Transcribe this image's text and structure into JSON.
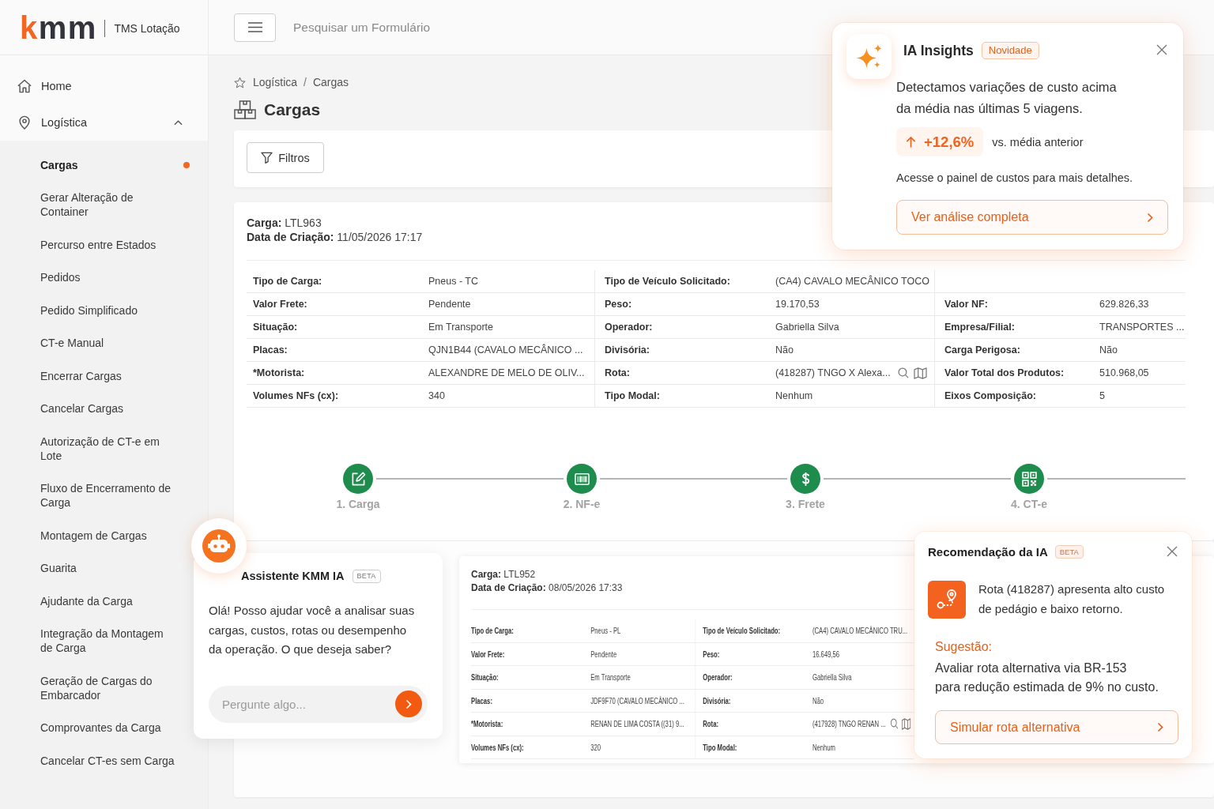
{
  "sidebar": {
    "logo": {
      "accent": "k",
      "text": "mm"
    },
    "product": "TMS Lotação",
    "nav": [
      {
        "kind": "link",
        "label": "Home"
      },
      {
        "kind": "group",
        "label": "Logística",
        "expanded": true,
        "children": [
          {
            "label": "Cargas",
            "selected": true
          },
          {
            "label": "Gerar Alteração de Container",
            "selected": false
          },
          {
            "label": "Percurso entre Estados",
            "selected": false
          },
          {
            "label": "Pedidos",
            "selected": false
          },
          {
            "label": "Pedido Simplificado",
            "selected": false
          },
          {
            "label": "CT-e Manual",
            "selected": false
          },
          {
            "label": "Encerrar Cargas",
            "selected": false
          },
          {
            "label": "Cancelar Cargas",
            "selected": false
          },
          {
            "label": "Autorização de CT-e em Lote",
            "selected": false
          },
          {
            "label": "Fluxo de Encerramento de Carga",
            "selected": false
          },
          {
            "label": "Montagem de Cargas",
            "selected": false
          },
          {
            "label": "Guarita",
            "selected": false
          },
          {
            "label": "Ajudante da Carga",
            "selected": false
          },
          {
            "label": "Integração da Montagem de Carga",
            "selected": false
          },
          {
            "label": "Geração de Cargas do Embarcador",
            "selected": false
          },
          {
            "label": "Comprovantes da Carga",
            "selected": false
          },
          {
            "label": "Cancelar CT-es sem Carga",
            "selected": false
          }
        ]
      }
    ]
  },
  "topbar": {
    "search": {
      "placeholder": "Pesquisar um Formulário"
    }
  },
  "breadcrumb": {
    "items": [
      "Logística",
      "Cargas"
    ],
    "separator": "/"
  },
  "page_title": "Cargas",
  "filters_button": "Filtros",
  "cargo_cards": [
    {
      "kind": "detail",
      "header": [
        {
          "label": "Carga:",
          "value": "LTL963"
        },
        {
          "label": "Data de Criação:",
          "value": "11/05/2026 17:17"
        }
      ],
      "rows": [
        [
          {
            "label": "Tipo de Carga:",
            "value": "Pneus - TC",
            "kind": "text"
          },
          {
            "label": "Tipo de Veículo Solicitado:",
            "value": "(CA4) CAVALO MECÂNICO TOCO",
            "kind": "text"
          }
        ],
        [
          {
            "label": "Valor Frete:",
            "value": "Pendente",
            "kind": "text"
          },
          {
            "label": "Peso:",
            "value": "19.170,53",
            "kind": "text"
          },
          {
            "label": "Valor NF:",
            "value": "629.826,33",
            "kind": "text"
          }
        ],
        [
          {
            "label": "Situação:",
            "value": "Em Transporte",
            "kind": "text"
          },
          {
            "label": "Operador:",
            "value": "Gabriella Silva",
            "kind": "text"
          },
          {
            "label": "Empresa/Filial:",
            "value": "TRANSPORTES ...",
            "kind": "text"
          }
        ],
        [
          {
            "label": "Placas:",
            "value": "QJN1B44 (CAVALO MECÂNICO ...",
            "kind": "text"
          },
          {
            "label": "Divisória:",
            "value": "Não",
            "kind": "text"
          },
          {
            "label": "Carga Perigosa:",
            "value": "Não",
            "kind": "text"
          }
        ],
        [
          {
            "label": "*Motorista:",
            "value": "ALEXANDRE DE MELO DE OLIV...",
            "kind": "text"
          },
          {
            "label": "Rota:",
            "value": "(418287) TNGO X Alexa...",
            "kind": "lookup"
          },
          {
            "label": "Valor Total dos Produtos:",
            "value": "510.968,05",
            "kind": "text"
          }
        ],
        [
          {
            "label": "Volumes NFs (cx):",
            "value": "340",
            "kind": "text"
          },
          {
            "label": "Tipo Modal:",
            "value": "Nenhum",
            "kind": "text"
          },
          {
            "label": "Eixos Composição:",
            "value": "5",
            "kind": "text"
          }
        ]
      ],
      "steps": [
        {
          "label": "1. Carga",
          "completed": true
        },
        {
          "label": "2. NF-e",
          "completed": true
        },
        {
          "label": "3. Frete",
          "completed": true
        },
        {
          "label": "4. CT-e",
          "completed": true
        }
      ]
    },
    {
      "kind": "summary",
      "header": [
        {
          "label": "Carga:",
          "value": "LTL952"
        },
        {
          "label": "Data de Criação:",
          "value": "08/05/2026 17:33"
        }
      ],
      "rows": [
        [
          {
            "label": "Tipo de Carga:",
            "value": "Pneus - PL",
            "kind": "text"
          },
          {
            "label": "Tipo de Veículo Solicitado:",
            "value": "(CA4) CAVALO MECÂNICO TRU...",
            "kind": "text"
          }
        ],
        [
          {
            "label": "Valor Frete:",
            "value": "Pendente",
            "kind": "text"
          },
          {
            "label": "Peso:",
            "value": "16.649,56",
            "kind": "text"
          }
        ],
        [
          {
            "label": "Situação:",
            "value": "Em Transporte",
            "kind": "text"
          },
          {
            "label": "Operador:",
            "value": "Gabriella Silva",
            "kind": "text"
          }
        ],
        [
          {
            "label": "Placas:",
            "value": "JDF9F70 (CAVALO MECÂNICO ...",
            "kind": "text"
          },
          {
            "label": "Divisória:",
            "value": "Não",
            "kind": "text"
          }
        ],
        [
          {
            "label": "*Motorista:",
            "value": "RENAN DE LIMA COSTA ((31) 9...",
            "kind": "text"
          },
          {
            "label": "Rota:",
            "value": "(417928) TNGO RENAN ...",
            "kind": "lookup"
          }
        ],
        [
          {
            "label": "Volumes NFs (cx):",
            "value": "320",
            "kind": "text"
          },
          {
            "label": "Tipo Modal:",
            "value": "Nenhum",
            "kind": "text"
          }
        ]
      ]
    }
  ],
  "insights": {
    "title": "IA Insights",
    "badge": "Novidade",
    "message": "Detectamos variações de custo acima\nda média nas últimas 5 viagens.",
    "change": "+12,6%",
    "comparison": "vs. média anterior",
    "note": "Acesse o painel de custos para mais detalhes.",
    "action": "Ver análise completa"
  },
  "assistant": {
    "title": "Assistente KMM IA",
    "badge": "BETA",
    "message": "Olá! Posso ajudar você a analisar suas\ncargas, custos, rotas ou desempenho\nda operação. O que deseja saber?",
    "input": {
      "placeholder": "Pergunte algo..."
    }
  },
  "recommendation": {
    "title": "Recomendação da IA",
    "badge": "BETA",
    "message": "Rota (418287) apresenta alto custo\nde pedágio e baixo retorno.",
    "suggestion_label": "Sugestão:",
    "suggestion": "Avaliar rota alternativa via BR-153\npara redução estimada de 9% no custo.",
    "action": "Simular rota alternativa"
  }
}
